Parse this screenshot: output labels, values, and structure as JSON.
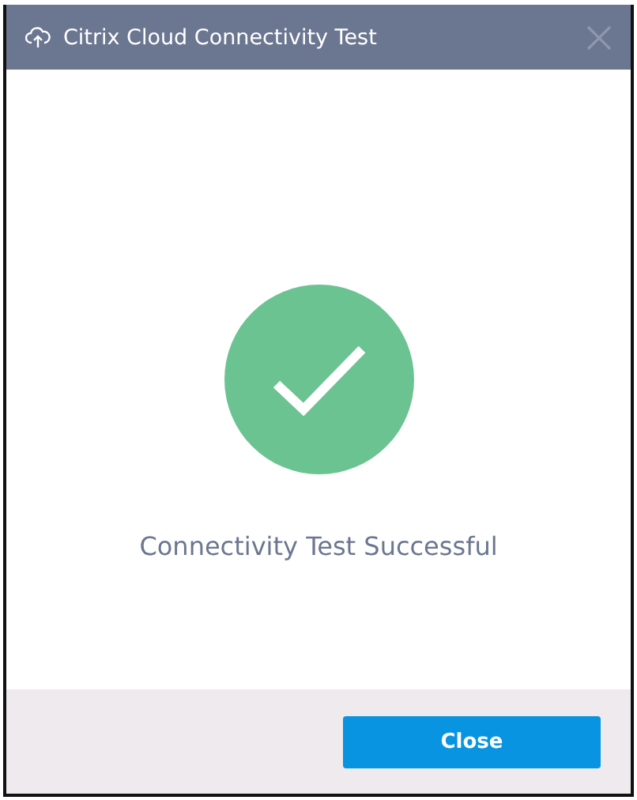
{
  "window": {
    "title": "Citrix Cloud Connectivity Test"
  },
  "result": {
    "success": true,
    "message": "Connectivity Test Successful"
  },
  "buttons": [
    "Close"
  ]
}
